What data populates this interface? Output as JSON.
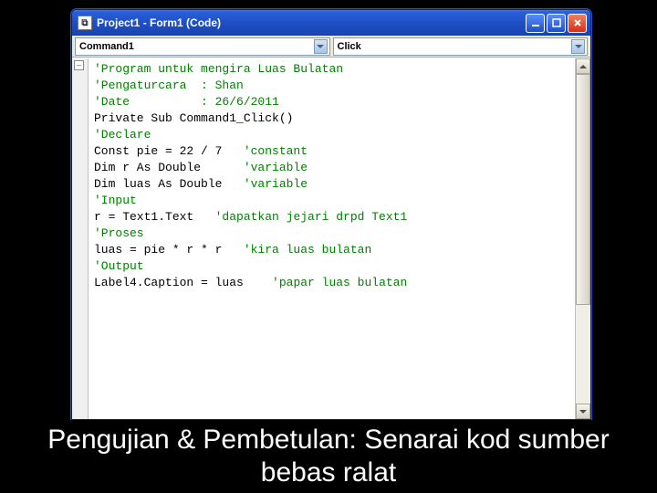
{
  "window": {
    "title": "Project1 - Form1 (Code)"
  },
  "dropdowns": {
    "object": "Command1",
    "procedure": "Click"
  },
  "code_lines": [
    {
      "cls": "cm",
      "t": "'Program untuk mengira Luas Bulatan"
    },
    {
      "cls": "cm",
      "t": "'Pengaturcara  : Shan"
    },
    {
      "cls": "cm",
      "t": "'Date          : 26/6/2011"
    },
    {
      "cls": "",
      "t": ""
    },
    {
      "cls": "",
      "t": "Private Sub Command1_Click()"
    },
    {
      "cls": "",
      "t": ""
    },
    {
      "cls": "cm",
      "t": "'Declare"
    },
    {
      "cls": "",
      "t": "Const pie = 22 / 7   ",
      "tail_cls": "cm",
      "tail": "'constant"
    },
    {
      "cls": "",
      "t": "Dim r As Double      ",
      "tail_cls": "cm",
      "tail": "'variable"
    },
    {
      "cls": "",
      "t": "Dim luas As Double   ",
      "tail_cls": "cm",
      "tail": "'variable"
    },
    {
      "cls": "",
      "t": ""
    },
    {
      "cls": "cm",
      "t": "'Input"
    },
    {
      "cls": "",
      "t": "r = Text1.Text   ",
      "tail_cls": "cm",
      "tail": "'dapatkan jejari drpd Text1"
    },
    {
      "cls": "",
      "t": ""
    },
    {
      "cls": "cm",
      "t": "'Proses"
    },
    {
      "cls": "",
      "t": "luas = pie * r * r   ",
      "tail_cls": "cm",
      "tail": "'kira luas bulatan"
    },
    {
      "cls": "",
      "t": ""
    },
    {
      "cls": "cm",
      "t": "'Output"
    },
    {
      "cls": "",
      "t": "Label4.Caption = luas    ",
      "tail_cls": "cm",
      "tail": "'papar luas bulatan"
    }
  ],
  "caption": "Pengujian & Pembetulan: Senarai kod sumber bebas ralat"
}
